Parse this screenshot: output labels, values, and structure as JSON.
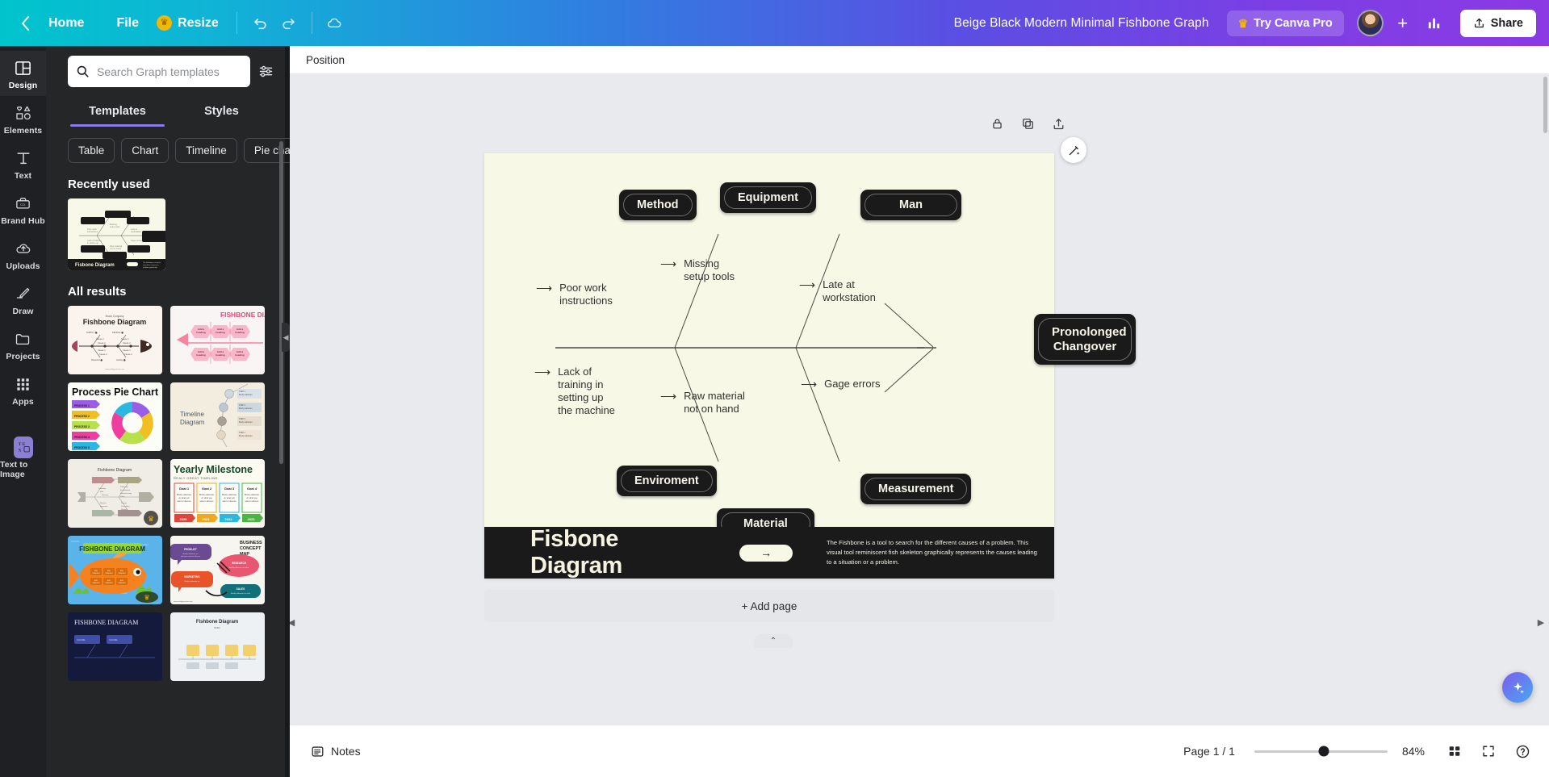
{
  "topbar": {
    "back_icon": "chevron-left-icon",
    "home": "Home",
    "file": "File",
    "resize": "Resize",
    "crown_icon": "crown-icon",
    "undo_icon": "undo-icon",
    "redo_icon": "redo-icon",
    "cloud_icon": "cloud-sync-icon",
    "title": "Beige Black Modern Minimal Fishbone Graph",
    "try_pro": "Try Canva Pro",
    "avatar": "user-avatar",
    "plus": "+",
    "insights_icon": "bar-chart-icon",
    "share": "Share",
    "share_icon": "share-upload-icon"
  },
  "rail": {
    "items": [
      {
        "label": "Design",
        "icon": "layout-icon",
        "active": true
      },
      {
        "label": "Elements",
        "icon": "shapes-icon",
        "active": false
      },
      {
        "label": "Text",
        "icon": "text-t-icon",
        "active": false
      },
      {
        "label": "Brand Hub",
        "icon": "briefcase-icon",
        "active": false
      },
      {
        "label": "Uploads",
        "icon": "cloud-upload-icon",
        "active": false
      },
      {
        "label": "Draw",
        "icon": "pencil-icon",
        "active": false
      },
      {
        "label": "Projects",
        "icon": "folder-icon",
        "active": false
      },
      {
        "label": "Apps",
        "icon": "grid-dots-icon",
        "active": false
      },
      {
        "label": "Text to Image",
        "icon": "text-to-image-icon",
        "active": false
      }
    ]
  },
  "panel": {
    "search": {
      "placeholder": "Search Graph templates",
      "value": "",
      "icon": "search-icon"
    },
    "filter_icon": "filter-sliders-icon",
    "tabs": [
      {
        "label": "Templates",
        "active": true
      },
      {
        "label": "Styles",
        "active": false
      }
    ],
    "chips": [
      "Table",
      "Chart",
      "Timeline",
      "Pie chart"
    ],
    "chips_next_icon": "chevron-right-icon",
    "recently_used_title": "Recently used",
    "recent_items": [
      {
        "name": "Beige Black Modern Minimal Fishbone Graph",
        "banner_text": "Fisbone Diagram"
      }
    ],
    "all_results_title": "All results",
    "results": [
      {
        "title": "Fishbone Diagram",
        "style": "cream-classic",
        "pro": false
      },
      {
        "title": "FISHBONE DIAGRAM",
        "style": "pink-hex",
        "pro": false
      },
      {
        "title": "Process Pie Chart",
        "style": "colorful-pie",
        "pro": false
      },
      {
        "title": "Timeline Diagram",
        "style": "beige-timeline",
        "pro": false
      },
      {
        "title": "Fishbone Diagram",
        "style": "muted-fishbone",
        "pro": true
      },
      {
        "title": "Yearly Milestone",
        "style": "green-milestone",
        "pro": false
      },
      {
        "title": "FISHBONE DIAGRAM",
        "style": "orange-fish",
        "pro": true
      },
      {
        "title": "BUSINESS CONCEPT MAP",
        "style": "concept-map",
        "pro": false
      },
      {
        "title": "FISHBONE DIAGRAM",
        "style": "navy-fishbone",
        "pro": false
      },
      {
        "title": "Fishbone Diagram",
        "style": "grey-fishbone",
        "pro": false
      }
    ],
    "milestone_sub": "REALY GREAT TIMELINE",
    "milestone_goals": [
      "Goal 1",
      "Goal 2",
      "Goal 3",
      "Goal 4"
    ],
    "milestone_years": [
      "2020",
      "2021",
      "2022",
      "2023"
    ],
    "process_labels": [
      "PROCESS 1",
      "PROCESS 2",
      "PROCESS 3",
      "PROCESS 4",
      "PROCESS 5"
    ],
    "concept_nodes": [
      "PRODUCT",
      "RESEARCH",
      "MARKETING",
      "SALES"
    ],
    "collapse_icon": "panel-collapse-icon"
  },
  "context_bar": {
    "position": "Position"
  },
  "canvas": {
    "tools": [
      "lock-icon",
      "duplicate-icon",
      "export-icon"
    ],
    "magic_icon": "magic-wand-icon",
    "add_page": "+ Add page"
  },
  "chart_data": {
    "type": "diagram",
    "diagram_kind": "fishbone-ishikawa",
    "title": "Fisbone Diagram",
    "effect": "Pronolonged Changover",
    "banner_description": "The Fishbone is a tool to search for the different causes of a problem. This visual tool reminiscent fish skeleton graphically represents the causes leading to a situation or a problem.",
    "banner_arrow": "→",
    "top_categories": [
      {
        "name": "Method",
        "causes": [
          "Poor work\ninstructions"
        ]
      },
      {
        "name": "Equipment",
        "causes": [
          "Missing\nsetup tools"
        ]
      },
      {
        "name": "Man",
        "causes": [
          "Late at\nworkstation"
        ]
      }
    ],
    "bottom_categories": [
      {
        "name": "Enviroment",
        "causes": [
          "Lack of\ntraining in\nsetting up\nthe machine"
        ]
      },
      {
        "name": "Material",
        "causes": [
          "Raw material\nnot on hand"
        ]
      },
      {
        "name": "Measurement",
        "causes": [
          "Gage errors"
        ]
      }
    ],
    "arrow_glyph": "⟶",
    "colors": {
      "page_bg": "#f7f8e6",
      "node_bg": "#1a1a1a",
      "node_text": "#f6f4e8",
      "spine": "#4a4a42"
    }
  },
  "bottombar": {
    "notes": "Notes",
    "notes_icon": "notes-icon",
    "page_indicator": "Page 1 / 1",
    "zoom_value": "84%",
    "grid_icon": "grid-view-icon",
    "fullscreen_icon": "fullscreen-icon",
    "help_icon": "help-icon",
    "ai_icon": "ai-sparkle-icon",
    "scroll_left_icon": "chevron-left-icon",
    "scroll_right_icon": "chevron-right-icon",
    "notes_collapse_icon": "chevron-up-icon"
  }
}
